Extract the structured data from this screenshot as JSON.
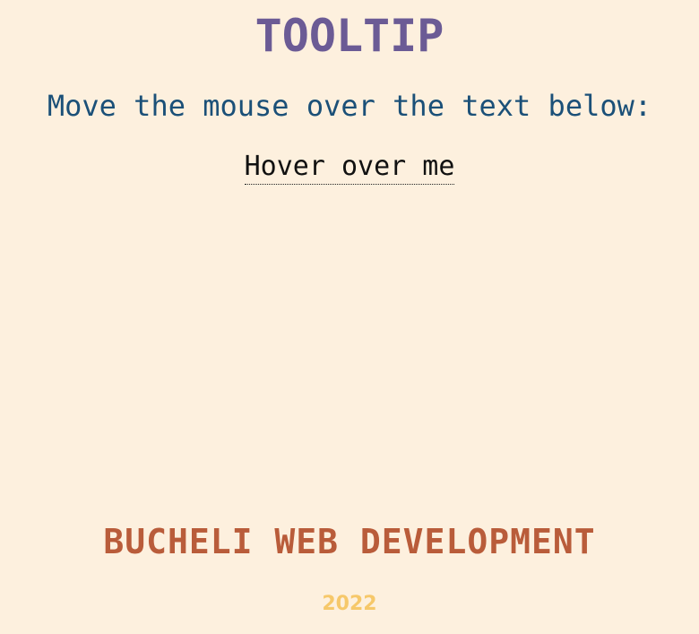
{
  "page": {
    "title": "TOOLTIP",
    "instruction": "Move the mouse over the text below:",
    "hover_text": "Hover over me"
  },
  "footer": {
    "brand": "BUCHELI WEB DEVELOPMENT",
    "year": "2022"
  },
  "colors": {
    "background": "#fdf0de",
    "title": "#6b5b95",
    "instruction": "#1b5078",
    "hover_text": "#111111",
    "footer_brand": "#b95c3a",
    "footer_year": "#f6c86a"
  }
}
